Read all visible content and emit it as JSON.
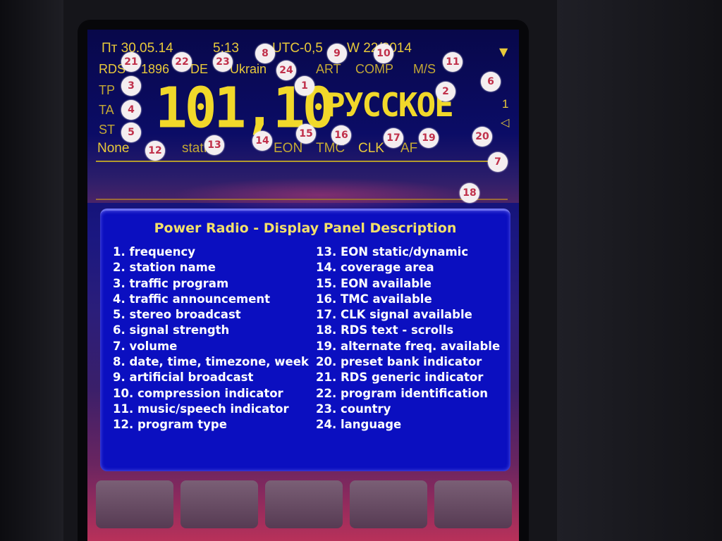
{
  "status_bar": {
    "date": "Пт  30.05.14",
    "time": "5:13",
    "timezone": "UTC-0,5",
    "week": "W 22/2014"
  },
  "rds_row": {
    "rds": "RDS",
    "pi": "1896",
    "country": "DE",
    "language": "Ukrain",
    "art": "ART",
    "comp": "COMP",
    "ms": "M/S"
  },
  "side_flags": {
    "tp": "TP",
    "ta": "TA",
    "st": "ST"
  },
  "frequency": "101,10",
  "station_name": "РУССКОЕ",
  "signal_strength": "1",
  "bottom_row": {
    "pty": "None",
    "eon_mode": "statR5",
    "eon": "EON",
    "tmc": "TMC",
    "clk": "CLK",
    "af": "AF"
  },
  "badges": [
    "1",
    "2",
    "3",
    "4",
    "5",
    "6",
    "7",
    "8",
    "9",
    "10",
    "11",
    "12",
    "13",
    "14",
    "15",
    "16",
    "17",
    "18",
    "19",
    "20",
    "21",
    "22",
    "23",
    "24"
  ],
  "panel": {
    "title": "Power Radio - Display Panel Description",
    "left_items": [
      "1. frequency",
      "2. station name",
      "3. traffic program",
      "4. traffic announcement",
      "5. stereo broadcast",
      "6. signal strength",
      "7. volume",
      "8. date, time, timezone, week",
      "9. artificial broadcast",
      "10. compression indicator",
      "11. music/speech indicator",
      "12. program type"
    ],
    "right_items": [
      "13. EON static/dynamic",
      "14. coverage area",
      "15. EON available",
      "16. TMC available",
      "17. CLK signal available",
      "18. RDS text - scrolls",
      "19. alternate freq. available",
      "20. preset bank indicator",
      "21. RDS generic indicator",
      "22. program identification",
      "23. country",
      "24. language"
    ]
  },
  "icons": {
    "antenna": "antenna-icon",
    "speaker": "speaker-icon"
  },
  "colors": {
    "display_yellow": "#e8c93a",
    "panel_blue": "#0b0fc0",
    "badge_red": "#c0304a"
  }
}
